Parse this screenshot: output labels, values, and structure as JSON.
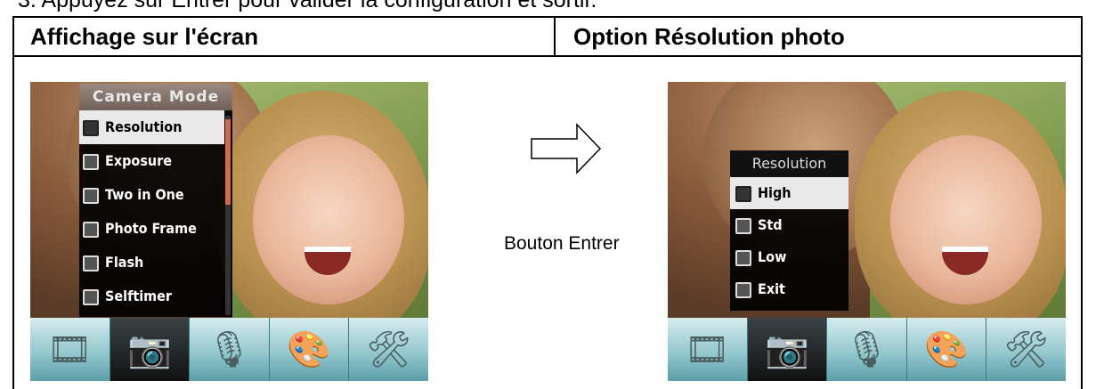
{
  "doc": {
    "top_line": "3. Appuyez sur Entrer pour valider la configuration et sortir."
  },
  "table": {
    "header_left": "Affichage sur l'écran",
    "header_right": "Option Résolution photo"
  },
  "screen_one": {
    "menu_title": "Camera Mode",
    "items": [
      {
        "label": "Resolution",
        "icon": "resolution-icon",
        "selected": true
      },
      {
        "label": "Exposure",
        "icon": "exposure-icon"
      },
      {
        "label": "Two in One",
        "icon": "two-in-one-icon"
      },
      {
        "label": "Photo Frame",
        "icon": "photo-frame-icon"
      },
      {
        "label": "Flash",
        "icon": "flash-icon"
      },
      {
        "label": "Selftimer",
        "icon": "selftimer-icon"
      }
    ]
  },
  "screen_two": {
    "menu_title": "Resolution",
    "items": [
      {
        "label": "High",
        "icon": "high-icon",
        "selected": true
      },
      {
        "label": "Std",
        "icon": "std-icon"
      },
      {
        "label": "Low",
        "icon": "low-icon"
      },
      {
        "label": "Exit",
        "icon": "exit-icon"
      }
    ]
  },
  "toolbar": [
    {
      "icon": "movie-reel-icon",
      "glyph": "🎞"
    },
    {
      "icon": "camera-icon",
      "glyph": "📷",
      "active": true
    },
    {
      "icon": "microphone-icon",
      "glyph": "🎙"
    },
    {
      "icon": "palette-icon",
      "glyph": "🎨"
    },
    {
      "icon": "tools-icon",
      "glyph": "🛠"
    }
  ],
  "arrow": {
    "label": "Bouton Entrer"
  },
  "colors": {
    "scrollbar_thumb": "#d2694e",
    "toolbar_teal": "#8ec4cb",
    "menu_bg": "#000000",
    "selected_bg": "#e9e9e9"
  }
}
